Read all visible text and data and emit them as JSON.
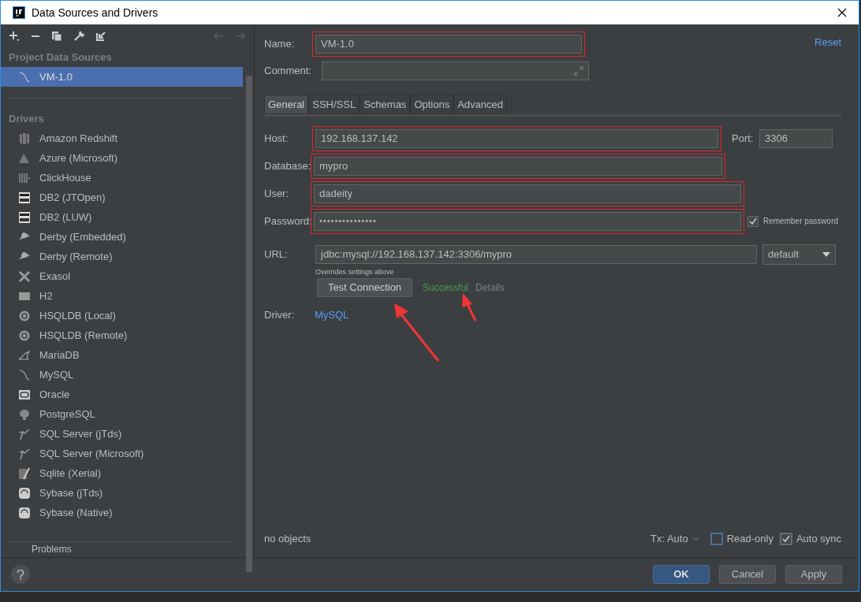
{
  "window": {
    "title": "Data Sources and Drivers"
  },
  "sidebar": {
    "project_header": "Project Data Sources",
    "project_sources": [
      {
        "label": "VM-1.0",
        "selected": true
      }
    ],
    "drivers_header": "Drivers",
    "drivers": [
      {
        "label": "Amazon Redshift",
        "selected": false
      },
      {
        "label": "Azure (Microsoft)",
        "selected": false
      },
      {
        "label": "ClickHouse",
        "selected": false
      },
      {
        "label": "DB2 (JTOpen)",
        "selected": false
      },
      {
        "label": "DB2 (LUW)",
        "selected": false
      },
      {
        "label": "Derby (Embedded)",
        "selected": false
      },
      {
        "label": "Derby (Remote)",
        "selected": false
      },
      {
        "label": "Exasol",
        "selected": false
      },
      {
        "label": "H2",
        "selected": false
      },
      {
        "label": "HSQLDB (Local)",
        "selected": false
      },
      {
        "label": "HSQLDB (Remote)",
        "selected": false
      },
      {
        "label": "MariaDB",
        "selected": false
      },
      {
        "label": "MySQL",
        "selected": false
      },
      {
        "label": "Oracle",
        "selected": false
      },
      {
        "label": "PostgreSQL",
        "selected": false
      },
      {
        "label": "SQL Server (jTds)",
        "selected": false
      },
      {
        "label": "SQL Server (Microsoft)",
        "selected": false
      },
      {
        "label": "Sqlite (Xerial)",
        "selected": false
      },
      {
        "label": "Sybase (jTds)",
        "selected": false
      },
      {
        "label": "Sybase (Native)",
        "selected": false
      }
    ],
    "problems": "Problems"
  },
  "form": {
    "name": {
      "label": "Name:",
      "value": "VM-1.0",
      "highlighted": true
    },
    "reset": "Reset",
    "comment": {
      "label": "Comment:"
    },
    "tabs": [
      {
        "label": "General",
        "selected": true
      },
      {
        "label": "SSH/SSL",
        "selected": false
      },
      {
        "label": "Schemas",
        "selected": false
      },
      {
        "label": "Options",
        "selected": false
      },
      {
        "label": "Advanced",
        "selected": false
      }
    ],
    "host": {
      "label": "Host:",
      "value": "192.168.137.142",
      "highlighted": true
    },
    "port": {
      "label": "Port:",
      "value": "3306"
    },
    "database": {
      "label": "Database:",
      "value": "mypro",
      "highlighted": true
    },
    "user": {
      "label": "User:",
      "value": "dadeity",
      "highlighted": true
    },
    "password": {
      "label": "Password:",
      "value": "•••••••••••••••",
      "highlighted": true
    },
    "remember_password": {
      "label": "Remember password",
      "checked": true
    },
    "url": {
      "label": "URL:",
      "value": "jdbc:mysql://192.168.137.142:3306/mypro",
      "mode": "default",
      "hint": "Overrides settings above"
    },
    "test_button": "Test Connection",
    "test_status": "Successful",
    "details": "Details",
    "driver": {
      "label": "Driver:",
      "value": "MySQL"
    }
  },
  "status": {
    "objects": "no objects",
    "tx": "Tx: Auto",
    "read_only": {
      "label": "Read-only",
      "checked": false
    },
    "auto_sync": {
      "label": "Auto sync",
      "checked": true
    }
  },
  "buttons": [
    {
      "label": "OK",
      "primary": true
    },
    {
      "label": "Cancel",
      "primary": false
    },
    {
      "label": "Apply",
      "primary": false
    }
  ]
}
